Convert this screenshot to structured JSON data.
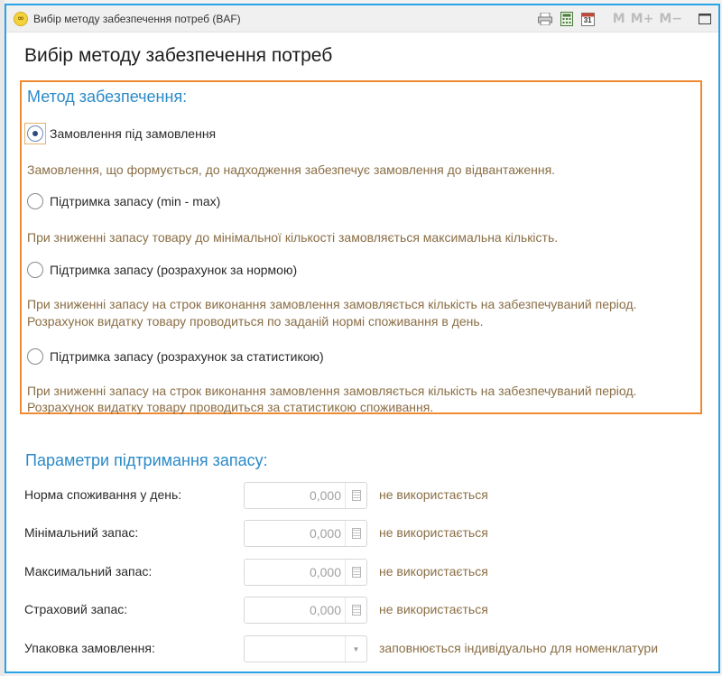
{
  "window": {
    "logo": "∞",
    "title": "Вибір методу забезпечення потреб  (BAF)",
    "toolbar": {
      "icons": [
        "printer-icon",
        "calculator-icon",
        "calendar-icon"
      ],
      "calendar_day": "31",
      "memory_buttons": [
        "M",
        "M+",
        "M−"
      ],
      "maximize_icon": "maximize-icon"
    }
  },
  "page": {
    "title": "Вибір методу забезпечення потреб"
  },
  "method": {
    "heading": "Метод забезпечення:",
    "options": [
      {
        "label": "Замовлення під замовлення",
        "checked": true,
        "desc": [
          "Замовлення, що формується, до надходження забезпечує замовлення до відвантаження."
        ]
      },
      {
        "label": "Підтримка запасу (min - max)",
        "checked": false,
        "desc": [
          "При зниженні запасу товару до мінімальної кількості замовляється максимальна кількість."
        ]
      },
      {
        "label": "Підтримка запасу (розрахунок за нормою)",
        "checked": false,
        "desc": [
          "При зниженні запасу на строк виконання замовлення замовляється кількість на забезпечуваний період.",
          "Розрахунок видатку товару проводиться по заданій нормі споживання в день."
        ]
      },
      {
        "label": "Підтримка запасу (розрахунок за статистикою)",
        "checked": false,
        "desc": [
          "При зниженні запасу на строк виконання замовлення замовляється кількість на забезпечуваний період.",
          "Розрахунок видатку товару проводиться за статистикою споживання."
        ]
      }
    ]
  },
  "params": {
    "heading": "Параметри підтримання запасу:",
    "rows": [
      {
        "label": "Норма споживання у день:",
        "value": "0,000",
        "note": "не використається"
      },
      {
        "label": "Мінімальний запас:",
        "value": "0,000",
        "note": "не використається"
      },
      {
        "label": "Максимальний запас:",
        "value": "0,000",
        "note": "не використається"
      },
      {
        "label": "Страховий запас:",
        "value": "0,000",
        "note": "не використається"
      }
    ],
    "packaging": {
      "label": "Упаковка замовлення:",
      "value": "",
      "note": "заповнюється індивідуально для номенклатури"
    }
  },
  "colors": {
    "accent_border": "#2aa3e6",
    "highlight_box": "#ef8a32",
    "section_heading": "#2b8ac8",
    "hint_text": "#8a6e45"
  }
}
